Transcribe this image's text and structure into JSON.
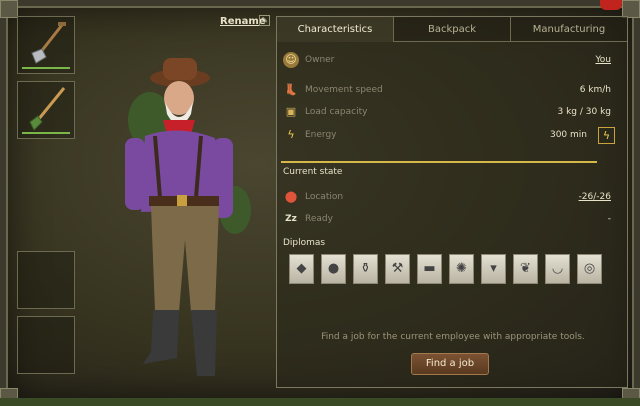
{
  "header": {
    "rename_label": "Rename"
  },
  "tabs": [
    {
      "label": "Characteristics",
      "active": true
    },
    {
      "label": "Backpack",
      "active": false
    },
    {
      "label": "Manufacturing",
      "active": false
    }
  ],
  "stats": {
    "owner": {
      "label": "Owner",
      "value": "You"
    },
    "speed": {
      "label": "Movement speed",
      "value": "6 km/h"
    },
    "load": {
      "label": "Load capacity",
      "value": "3 kg / 30 kg"
    },
    "energy": {
      "label": "Energy",
      "value": "300 min"
    }
  },
  "current_state": {
    "title": "Current state",
    "location": {
      "label": "Location",
      "value": "-26/-26"
    },
    "status": {
      "label": "Ready",
      "value": "-"
    }
  },
  "diplomas": {
    "title": "Diplomas",
    "icons": [
      "stone-icon",
      "ore-icon",
      "pot-icon",
      "hammers-icon",
      "anvil-icon",
      "wheel-icon",
      "cart-icon",
      "grains-icon",
      "bowl-icon",
      "plate-icon"
    ]
  },
  "footer": {
    "hint": "Find a job for the current employee with appropriate tools.",
    "find_job_label": "Find a job"
  },
  "colors": {
    "accent": "#d6b84a",
    "button": "#6a4529",
    "tool_bar": "#7ab648"
  }
}
